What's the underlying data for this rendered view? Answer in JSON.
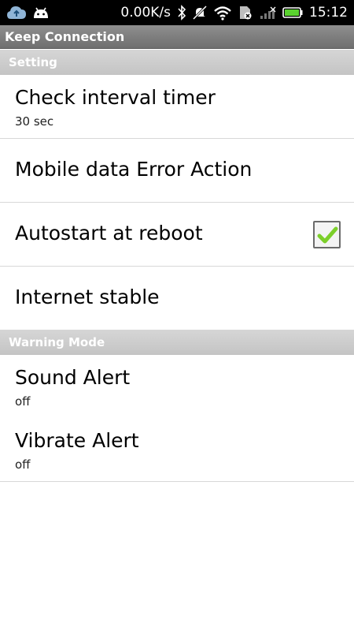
{
  "status_bar": {
    "left_icons": [
      "cloud-upload-icon",
      "android-icon"
    ],
    "network_speed": "0.00K/s",
    "right_icons": [
      "bluetooth-icon",
      "notifications-muted-icon",
      "wifi-icon",
      "sim-icon",
      "cell-signal-icon",
      "battery-icon"
    ],
    "time": "15:12",
    "battery_color": "#5ad22f"
  },
  "app": {
    "title": "Keep Connection"
  },
  "sections": [
    {
      "header": "Setting",
      "items": [
        {
          "title": "Check interval timer",
          "summary": "30 sec"
        },
        {
          "title": "Mobile data Error Action"
        },
        {
          "title": "Autostart at reboot",
          "checked": true,
          "check_icon": "check-icon"
        },
        {
          "title": "Internet stable"
        }
      ]
    },
    {
      "header": "Warning Mode",
      "items": [
        {
          "title": "Sound Alert",
          "summary": "off"
        },
        {
          "title": "Vibrate Alert",
          "summary": "off"
        }
      ]
    }
  ],
  "colors": {
    "checkmark": "#7ccf2a",
    "section_header_text": "#ffffff",
    "title_bar": "#7f7f7f"
  }
}
